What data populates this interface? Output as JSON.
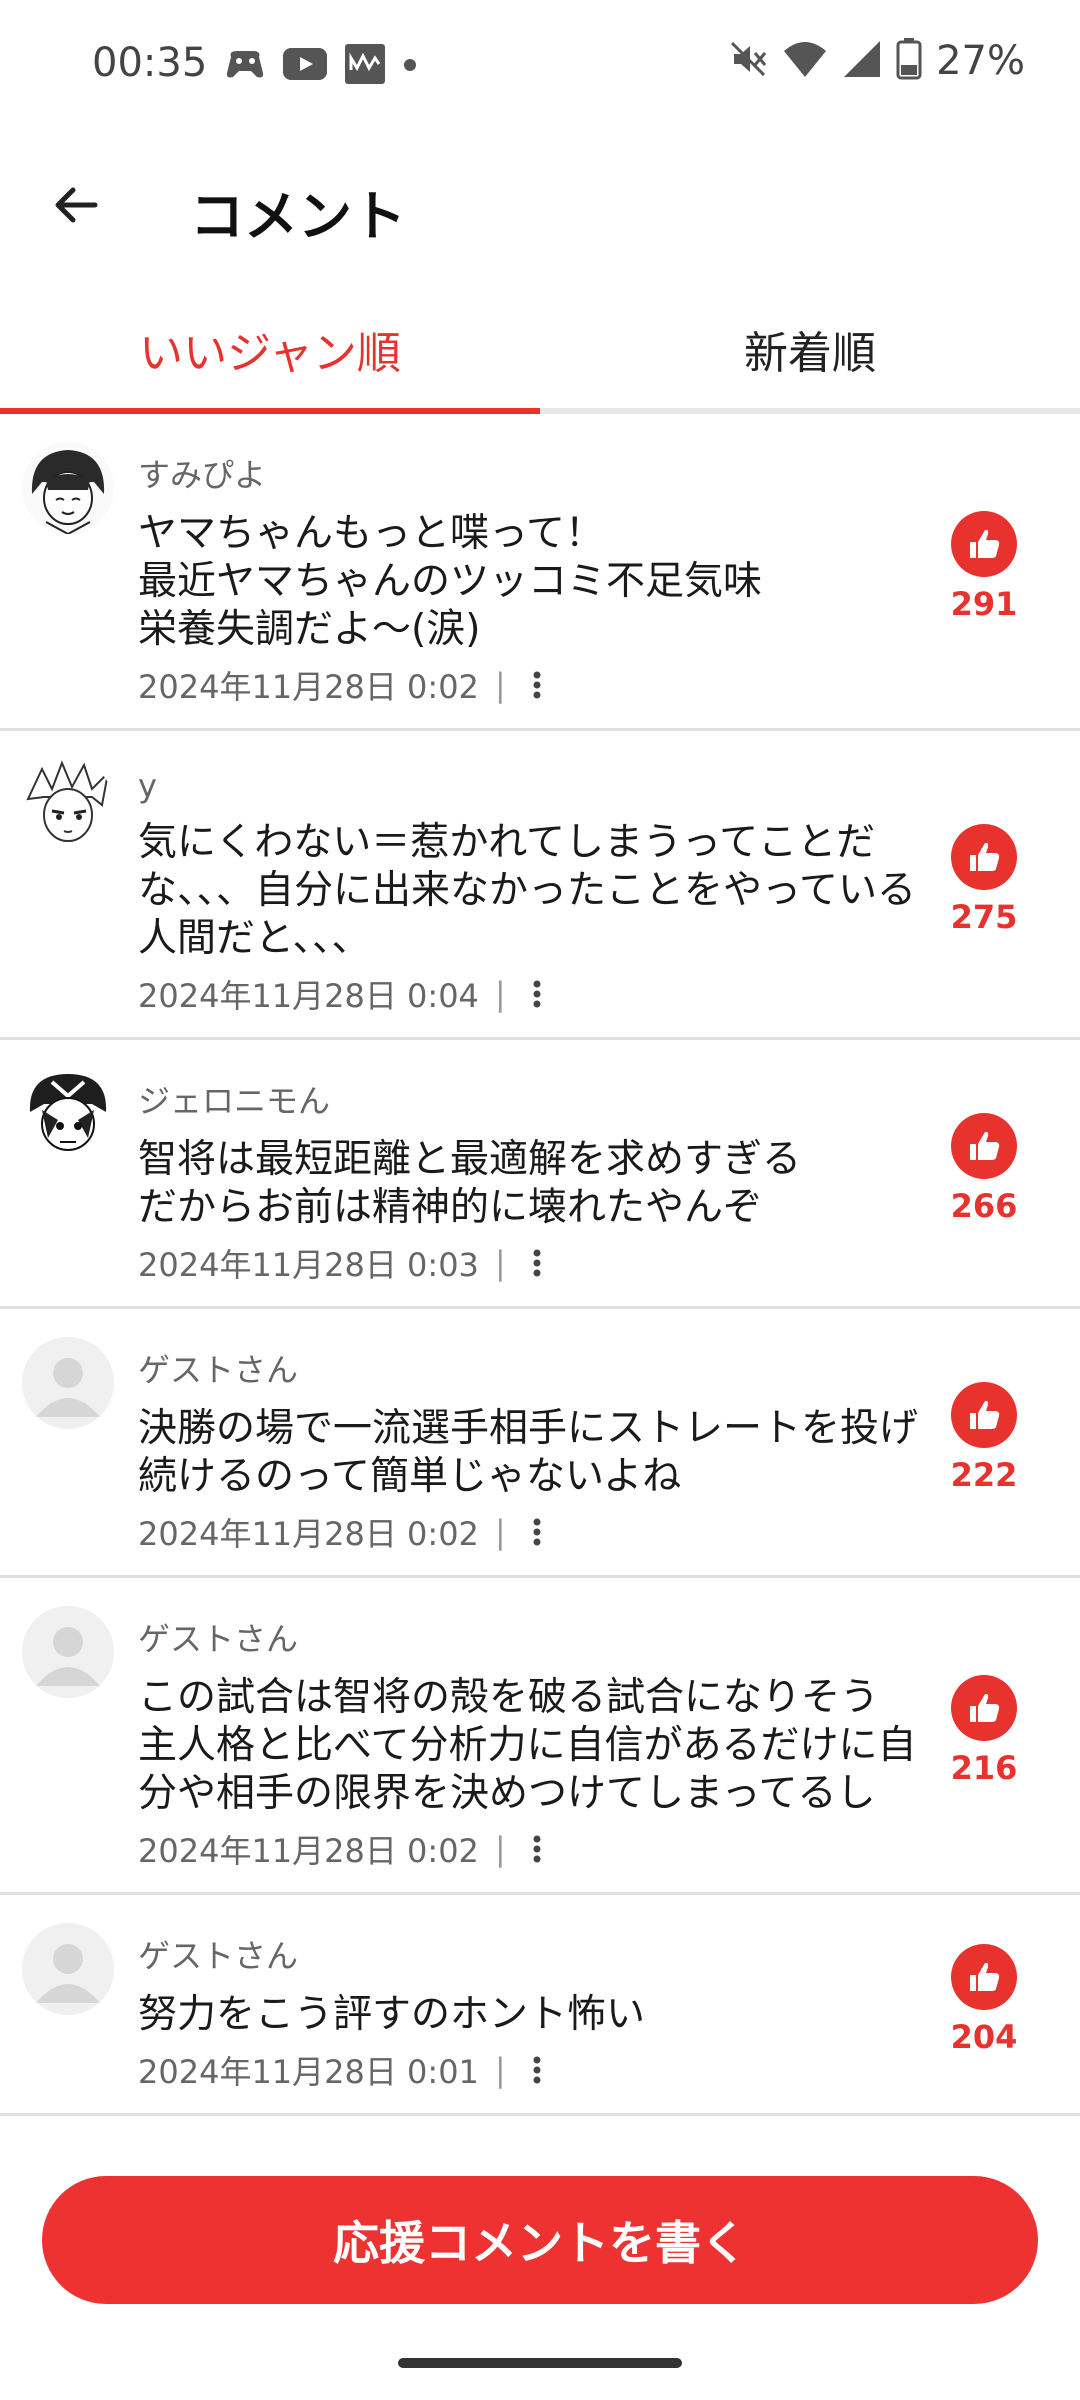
{
  "status_bar": {
    "time": "00:35",
    "battery_pct": "27%",
    "left_icons": [
      "game-controller-icon",
      "youtube-icon",
      "app-icon",
      "dot-icon"
    ],
    "right_icons": [
      "mute-icon",
      "wifi-icon",
      "signal-icon",
      "battery-icon"
    ]
  },
  "header": {
    "title": "コメント"
  },
  "tabs": [
    {
      "label": "いいジャン順",
      "active": true
    },
    {
      "label": "新着順",
      "active": false
    }
  ],
  "comments": [
    {
      "user": "すみぴよ",
      "text": "ヤマちゃんもっと喋って！\n最近ヤマちゃんのツッコミ不足気味\n栄養失調だよ〜(涙)",
      "date": "2024年11月28日 0:02",
      "likes": "291",
      "avatar": "manga-boy"
    },
    {
      "user": "y",
      "text": "気にくわない＝惹かれてしまうってことだな、、、自分に出来なかったことをやっている人間だと、、、",
      "date": "2024年11月28日 0:04",
      "likes": "275",
      "avatar": "manga-hair"
    },
    {
      "user": "ジェロニモん",
      "text": "智将は最短距離と最適解を求めすぎる\nだからお前は精神的に壊れたやんぞ",
      "date": "2024年11月28日 0:03",
      "likes": "266",
      "avatar": "manga-helmet"
    },
    {
      "user": "ゲストさん",
      "text": "決勝の場で一流選手相手にストレートを投げ続けるのって簡単じゃないよね",
      "date": "2024年11月28日 0:02",
      "likes": "222",
      "avatar": "guest"
    },
    {
      "user": "ゲストさん",
      "text": "この試合は智将の殻を破る試合になりそう\n主人格と比べて分析力に自信があるだけに自分や相手の限界を決めつけてしまってるし",
      "date": "2024年11月28日 0:02",
      "likes": "216",
      "avatar": "guest"
    },
    {
      "user": "ゲストさん",
      "text": "努力をこう評すのホント怖い",
      "date": "2024年11月28日 0:01",
      "likes": "204",
      "avatar": "guest"
    }
  ],
  "cta": {
    "label": "応援コメントを書く"
  },
  "colors": {
    "accent": "#e8322e",
    "cta": "#ee3232"
  }
}
